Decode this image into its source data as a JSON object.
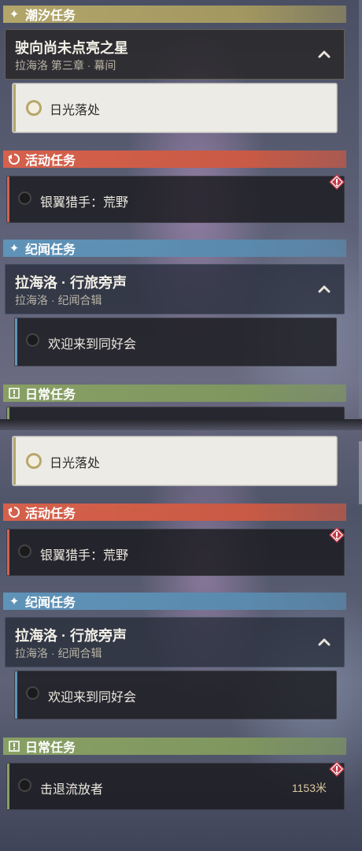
{
  "panel_top": {
    "tide_category": {
      "label": "潮汐任务"
    },
    "tide_header": {
      "title": "驶向尚未点亮之星",
      "subtitle": "拉海洛 第三章 · 幕间"
    },
    "tide_task": {
      "label": "日光落处"
    },
    "event_category": {
      "label": "活动任务"
    },
    "event_task": {
      "label": "银翼猎手：荒野"
    },
    "lore_category": {
      "label": "纪闻任务"
    },
    "lore_header": {
      "title": "拉海洛 · 行旅旁声",
      "subtitle": "拉海洛 · 纪闻合辑"
    },
    "lore_task": {
      "label": "欢迎来到同好会"
    },
    "daily_category": {
      "label": "日常任务"
    }
  },
  "panel_bottom": {
    "tide_task": {
      "label": "日光落处"
    },
    "event_category": {
      "label": "活动任务"
    },
    "event_task": {
      "label": "银翼猎手：荒野"
    },
    "lore_category": {
      "label": "纪闻任务"
    },
    "lore_header": {
      "title": "拉海洛 · 行旅旁声",
      "subtitle": "拉海洛 · 纪闻合辑"
    },
    "lore_task": {
      "label": "欢迎来到同好会"
    },
    "daily_category": {
      "label": "日常任务"
    },
    "daily_task": {
      "label": "击退流放者",
      "distance": "1153米"
    }
  },
  "colors": {
    "tide": "#b2a66a",
    "event": "#d5614c",
    "lore": "#5f93b8",
    "daily": "#88a064",
    "warning": "#c23b4a"
  },
  "icons": {
    "tide": "sparkle-icon",
    "event": "loop-arrow-icon",
    "lore": "sparkle-icon",
    "daily": "exclamation-box-icon",
    "collapse": "chevron-up-icon",
    "alert": "warning-diamond-icon"
  }
}
